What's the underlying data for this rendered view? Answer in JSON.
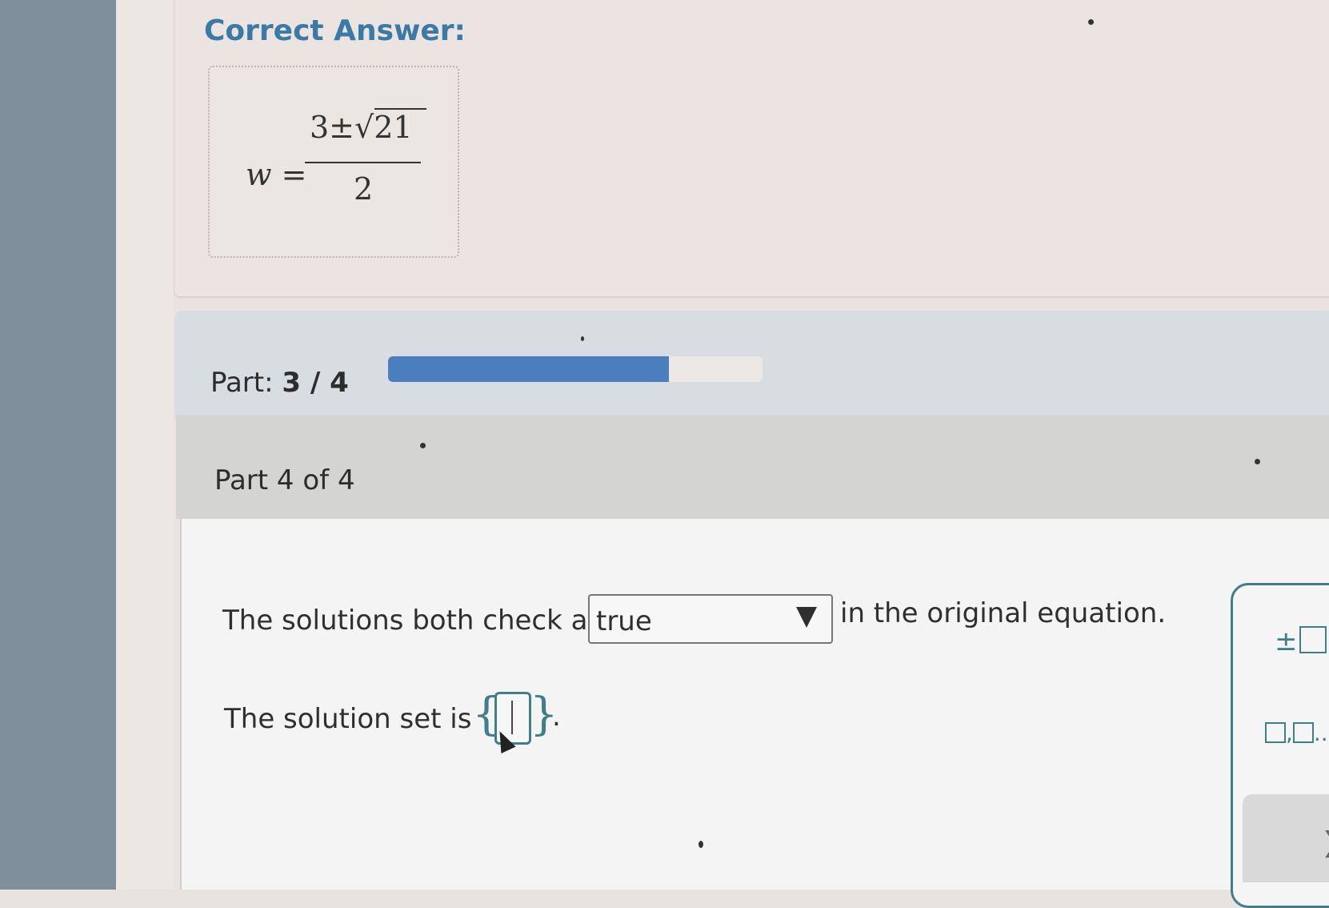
{
  "correct_answer": {
    "title": "Correct Answer:",
    "lhs": "w =",
    "numerator_prefix": "3±",
    "radicand": "21",
    "denominator": "2"
  },
  "progress": {
    "label_prefix": "Part:",
    "label_value": "3 / 4",
    "fraction": 0.75
  },
  "part_header": {
    "title": "Part 4 of 4"
  },
  "question": {
    "sentence1_before": "The solutions both check as",
    "dropdown_value": "true",
    "sentence1_after": "in the original equation.",
    "sentence2": "The solution set is",
    "set_open": "{",
    "set_close": "}",
    "period": "."
  },
  "tool_panel": {
    "plus_minus": "±",
    "list_sep": ",",
    "list_ellipsis": "...",
    "accent_color": "#3f7f8a"
  },
  "nav": {
    "next_symbol": "❯"
  },
  "colors": {
    "title_blue": "#3a7aa6",
    "progress_fill": "#4a7ebf"
  }
}
